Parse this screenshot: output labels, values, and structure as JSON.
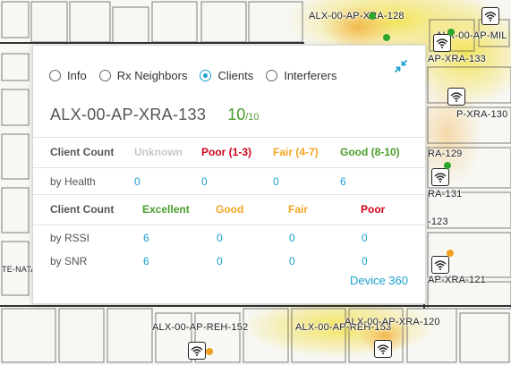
{
  "map": {
    "ap_labels": [
      {
        "text": "ALX-00-AP-XRA-128"
      },
      {
        "text": "ALX-00-AP-MIL"
      },
      {
        "text": "AP-XRA-133"
      },
      {
        "text": "P-XRA-130"
      },
      {
        "text": "RA-129"
      },
      {
        "text": "RA-131"
      },
      {
        "text": "-123"
      },
      {
        "text": "AP-XRA-121"
      },
      {
        "text": "ALX-00-AP-REH-152"
      },
      {
        "text": "ALX-00-AP-REH-153"
      },
      {
        "text": "ALX-00-AP-XRA-120"
      },
      {
        "text": "TE-NATAL"
      }
    ],
    "colors": {
      "dot_green": "#2ea62e",
      "dot_orange": "#f0a020",
      "heat_yellow": "#f2e86a",
      "heat_orange": "#f5c060"
    }
  },
  "popup": {
    "tabs": [
      {
        "label": "Info",
        "selected": false
      },
      {
        "label": "Rx Neighbors",
        "selected": false
      },
      {
        "label": "Clients",
        "selected": true
      },
      {
        "label": "Interferers",
        "selected": false
      }
    ],
    "collapse_icon": "collapse-arrows-icon",
    "ap_name": "ALX-00-AP-XRA-133",
    "client_count": "10",
    "client_total": "/10",
    "health_header": {
      "label": "Client Count",
      "unknown": "Unknown",
      "poor": "Poor (1-3)",
      "fair": "Fair (4-7)",
      "good": "Good (8-10)"
    },
    "by_health": {
      "label": "by Health",
      "unknown": "0",
      "poor": "0",
      "fair": "0",
      "good": "6"
    },
    "quality_header": {
      "label": "Client Count",
      "excellent": "Excellent",
      "good": "Good",
      "fair": "Fair",
      "poor": "Poor"
    },
    "by_rssi": {
      "label": "by RSSI",
      "excellent": "6",
      "good": "0",
      "fair": "0",
      "poor": "0"
    },
    "by_snr": {
      "label": "by SNR",
      "excellent": "6",
      "good": "0",
      "fair": "0",
      "poor": "0"
    },
    "link": "Device 360",
    "colors": {
      "unknown": "#c8c8c8",
      "poor": "#d0021b",
      "fair": "#f5a623",
      "good": "#4a9d2b",
      "excellent": "#4a9d2b",
      "link": "#1a9fd0",
      "count": "#4a9d2b"
    }
  }
}
